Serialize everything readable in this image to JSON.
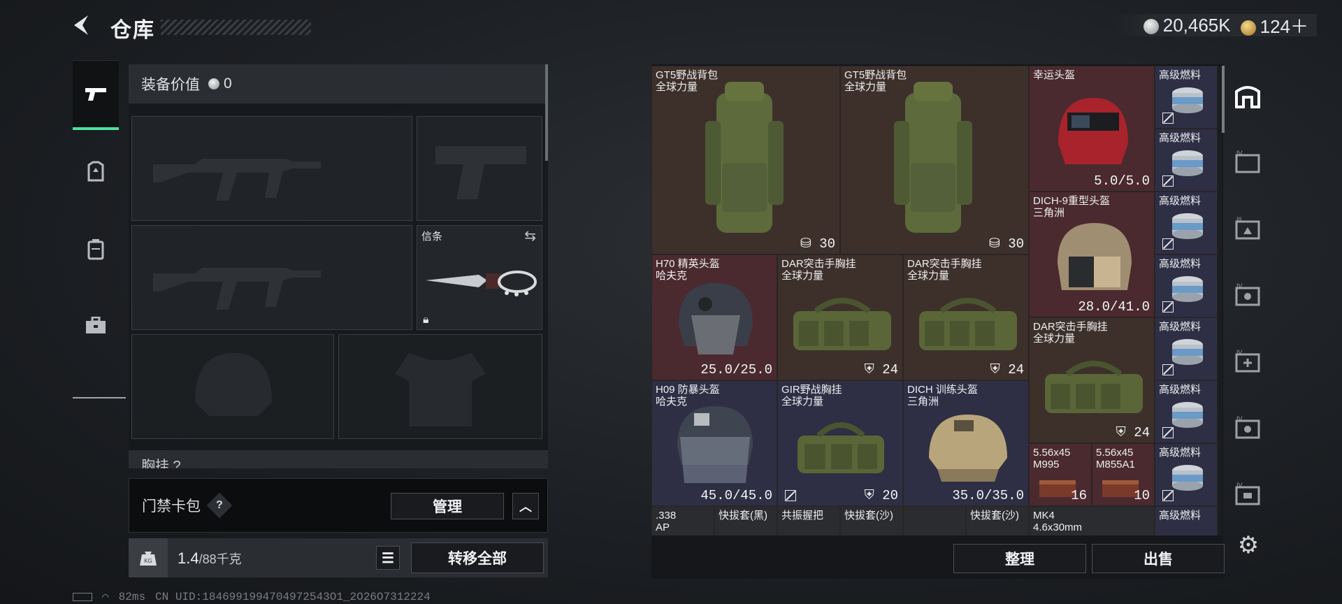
{
  "header": {
    "title": "仓库",
    "silver_amount": "20,465K",
    "gold_amount": "124＋"
  },
  "equipment": {
    "value_label": "装备价值",
    "value": "0",
    "melee_label": "信条",
    "partial_row_label": "胸挂 ?"
  },
  "keycard": {
    "label": "门禁卡包",
    "help": "?",
    "manage_button": "管理"
  },
  "weight": {
    "current": "1.4",
    "capacity": "/88千克",
    "transfer_all_button": "转移全部"
  },
  "inventory": {
    "items": [
      {
        "name": "GT5野战背包\n全球力量",
        "value": "30"
      },
      {
        "name": "GT5野战背包\n全球力量",
        "value": "30"
      },
      {
        "name": "幸运头盔",
        "value": "5.0/5.0"
      },
      {
        "name": "高级燃料"
      },
      {
        "name": "高级燃料"
      },
      {
        "name": "DICH-9重型头盔\n三角洲",
        "value": "28.0/41.0"
      },
      {
        "name": "高级燃料"
      },
      {
        "name": "H70 精英头盔\n哈夫克",
        "value": "25.0/25.0"
      },
      {
        "name": "DAR突击手胸挂\n全球力量",
        "value": "24"
      },
      {
        "name": "DAR突击手胸挂\n全球力量",
        "value": "24"
      },
      {
        "name": "高级燃料"
      },
      {
        "name": "DAR突击手胸挂\n全球力量",
        "value": "24"
      },
      {
        "name": "高级燃料"
      },
      {
        "name": "高级燃料"
      },
      {
        "name": "H09 防暴头盔\n哈夫克",
        "value": "45.0/45.0"
      },
      {
        "name": "GIR野战胸挂\n全球力量",
        "value": "20"
      },
      {
        "name": "DICH 训练头盔\n三角洲",
        "value": "35.0/35.0"
      },
      {
        "name": "5.56x45\nM995",
        "value": "16"
      },
      {
        "name": "5.56x45\nM855A1",
        "value": "10"
      },
      {
        "name": "高级燃料"
      },
      {
        "name": ".338\nAP"
      },
      {
        "name": "快拔套(黑)"
      },
      {
        "name": "共振握把"
      },
      {
        "name": "快拔套(沙)"
      },
      {
        "name": "快拔套(沙)"
      },
      {
        "name": "MK4\n4.6x30mm"
      },
      {
        "name": "高级燃料"
      }
    ],
    "sort_button": "整理",
    "sell_button": "出售"
  },
  "status": {
    "ping": "82ms",
    "uid": "CN UID:1846991994704972543O1_2O26O7312224"
  },
  "colors": {
    "accent": "#4fe0a0",
    "cell_brown": "#3d302a",
    "cell_red": "#4a2a2e",
    "cell_blue": "#2e2f44"
  }
}
